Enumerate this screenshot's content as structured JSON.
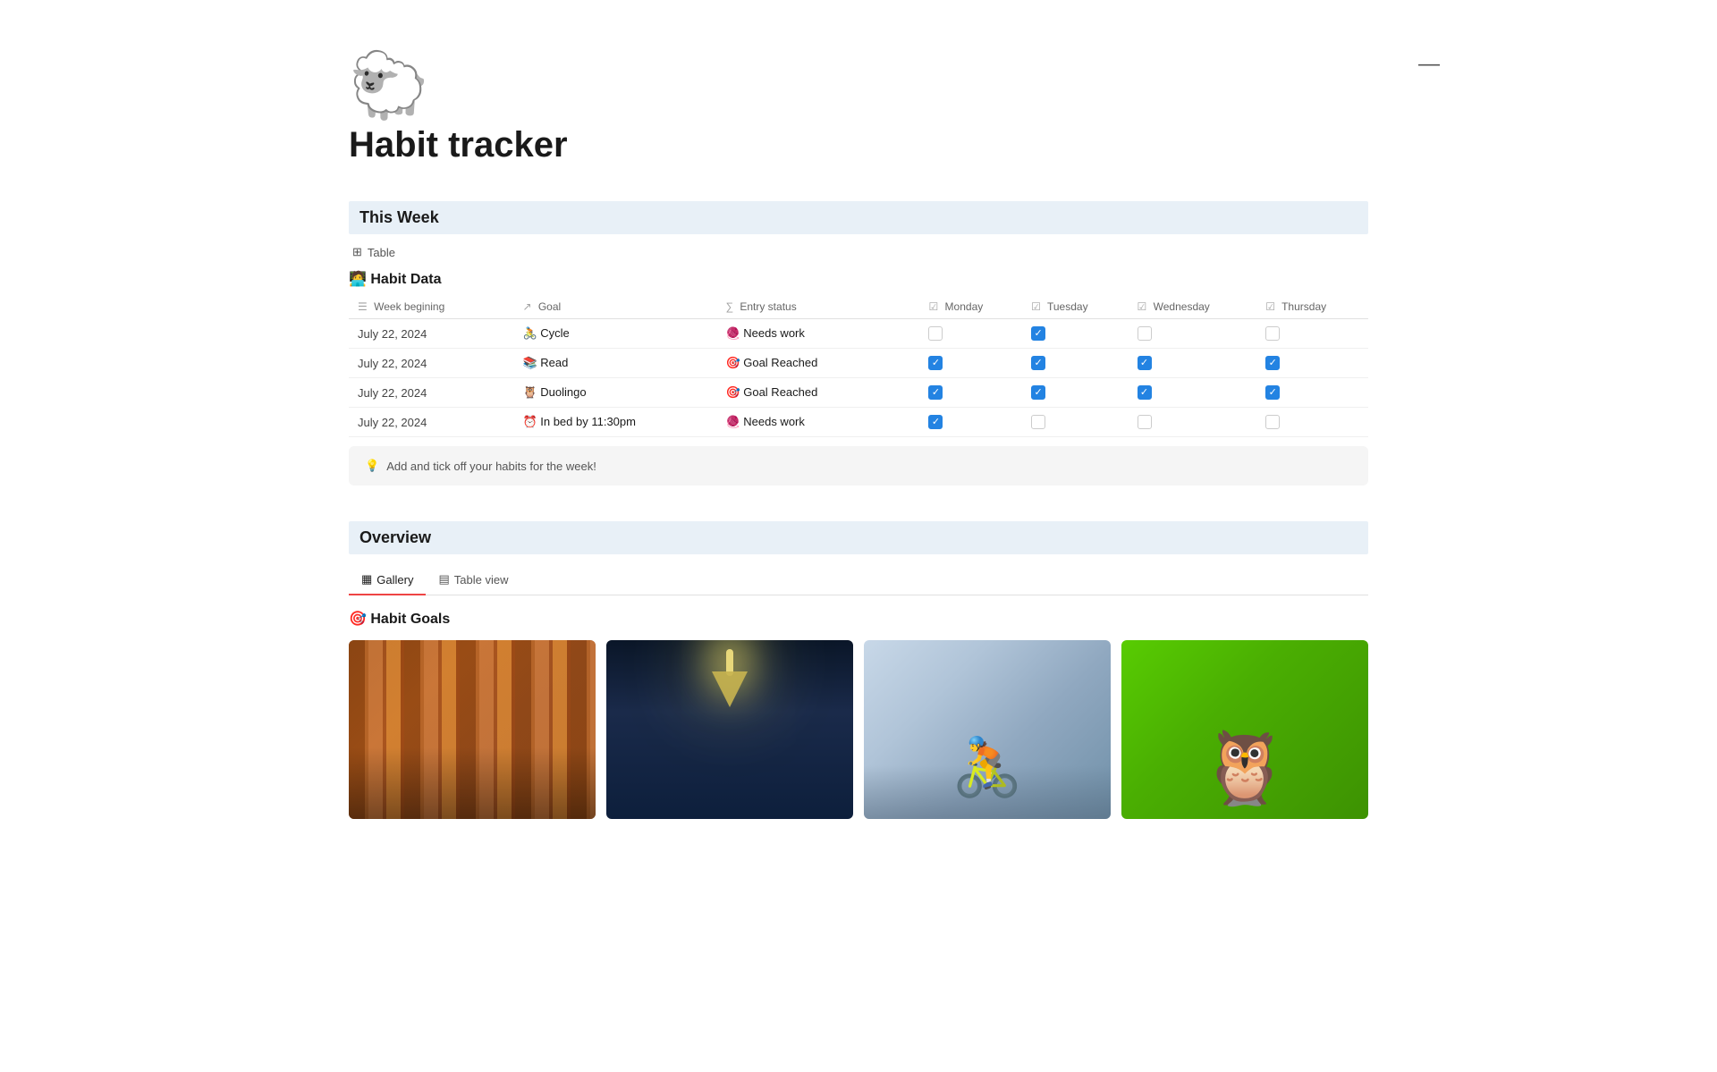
{
  "page": {
    "icon": "🐑",
    "title": "Habit tracker",
    "minimize_button": "—"
  },
  "this_week": {
    "section_title": "This Week",
    "table_label": "Table",
    "habit_section_title": "🧑‍💻 Habit Data",
    "columns": {
      "week_beginning": "Week begining",
      "goal": "Goal",
      "entry_status": "Entry status",
      "monday": "Monday",
      "tuesday": "Tuesday",
      "wednesday": "Wednesday",
      "thursday": "Thursday"
    },
    "rows": [
      {
        "date": "July 22, 2024",
        "goal_icon": "🚴",
        "goal": "Cycle",
        "status_icon": "🧶",
        "status": "Needs work",
        "monday": false,
        "tuesday": true,
        "wednesday": false,
        "thursday": false
      },
      {
        "date": "July 22, 2024",
        "goal_icon": "📚",
        "goal": "Read",
        "status_icon": "🎯",
        "status": "Goal Reached",
        "monday": true,
        "tuesday": true,
        "wednesday": true,
        "thursday": true
      },
      {
        "date": "July 22, 2024",
        "goal_icon": "🦉",
        "goal": "Duolingo",
        "status_icon": "🎯",
        "status": "Goal Reached",
        "monday": true,
        "tuesday": true,
        "wednesday": true,
        "thursday": true
      },
      {
        "date": "July 22, 2024",
        "goal_icon": "⏰",
        "goal": "In bed by 11:30pm",
        "status_icon": "🧶",
        "status": "Needs work",
        "monday": true,
        "tuesday": false,
        "wednesday": false,
        "thursday": false
      }
    ]
  },
  "tip": {
    "icon": "💡",
    "text": "Add and tick off your habits for the week!"
  },
  "overview": {
    "section_title": "Overview",
    "tabs": [
      {
        "label": "Gallery",
        "icon": "▦",
        "active": true
      },
      {
        "label": "Table view",
        "icon": "▤",
        "active": false
      }
    ],
    "habit_goals_title": "🎯 Habit Goals",
    "cards": [
      {
        "type": "books",
        "label": "Books"
      },
      {
        "type": "lamp",
        "label": "Lamp"
      },
      {
        "type": "cycle",
        "label": "Cycle"
      },
      {
        "type": "duolingo",
        "label": "Duolingo"
      }
    ]
  }
}
